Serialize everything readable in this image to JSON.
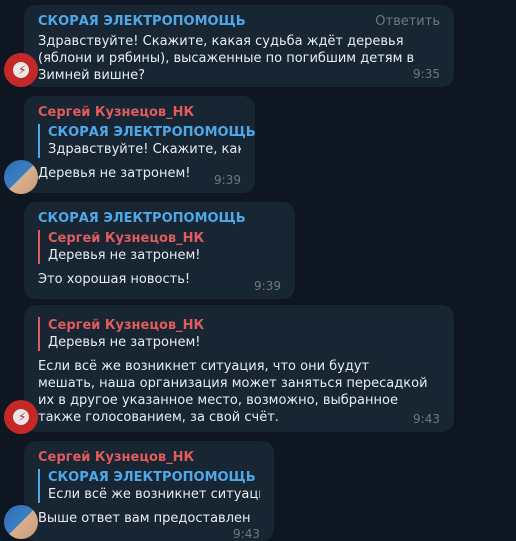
{
  "messages": [
    {
      "sender": "СКОРАЯ ЭЛЕКТРОПОМОЩЬ",
      "reply_action": "Ответить",
      "text": "Здравствуйте! Скажите, какая судьба ждёт деревья (яблони и рябины), высаженные по погибшим детям в Зимней вишне?",
      "time": "9:35"
    },
    {
      "sender": "Сергей Кузнецов_НК",
      "quote_author": "СКОРАЯ ЭЛЕКТРОПОМОЩЬ",
      "quote_text": "Здравствуйте! Скажите, какая...",
      "text": "Деревья не затронем!",
      "time": "9:39"
    },
    {
      "sender": "СКОРАЯ ЭЛЕКТРОПОМОЩЬ",
      "quote_author": "Сергей Кузнецов_НК",
      "quote_text": "Деревья не затронем!",
      "text": "Это хорошая новость!",
      "time": "9:39"
    },
    {
      "quote_author": "Сергей Кузнецов_НК",
      "quote_text": "Деревья не затронем!",
      "text": "Если всё же возникнет ситуация, что они будут мешать, наша организация может заняться пересадкой их в другое указанное место, возможно, выбранное также голосованием, за свой счёт.",
      "time": "9:43"
    },
    {
      "sender": "Сергей Кузнецов_НК",
      "quote_author": "СКОРАЯ ЭЛЕКТРОПОМОЩЬ",
      "quote_text": "Если всё же возникнет ситуация, ...",
      "text": "Выше ответ вам предоставлен",
      "time": "9:43"
    }
  ],
  "colors": {
    "background": "#0e1621",
    "bubble": "#182533",
    "blue_name": "#4fa8e8",
    "red_name": "#e05c5c",
    "meta": "#6c7883"
  }
}
